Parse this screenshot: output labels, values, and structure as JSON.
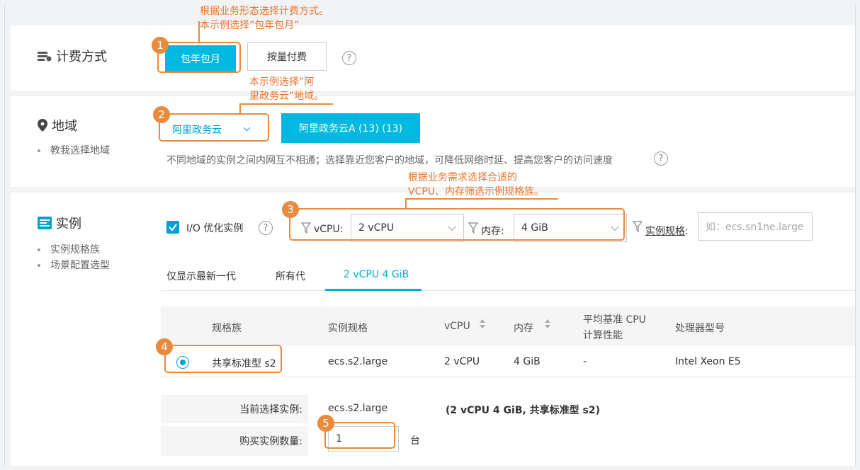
{
  "billing": {
    "title": "计费方式",
    "options": [
      "包年包月",
      "按量付费"
    ],
    "selected": "包年包月"
  },
  "region": {
    "title": "地域",
    "help_link": "教我选择地域",
    "select_value": "阿里政务云",
    "zone_button": "阿里政务云A (13) (13)",
    "note": "不同地域的实例之间内网互不相通；选择靠近您客户的地域，可降低网络时延、提高您客户的访问速度"
  },
  "instance": {
    "title": "实例",
    "links": [
      "实例规格族",
      "场景配置选型"
    ],
    "io_optimized_label": "I/O 优化实例",
    "io_optimized_checked": true,
    "filters": {
      "vcpu_label": "vCPU:",
      "vcpu_value": "2 vCPU",
      "memory_label": "内存:",
      "memory_value": "4 GiB",
      "spec_label": "实例规格",
      "spec_colon": ":",
      "spec_placeholder": "如：ecs.sn1ne.large"
    },
    "tabs": [
      "仅显示最新一代",
      "所有代",
      "2 vCPU 4 GiB"
    ],
    "active_tab": "2 vCPU 4 GiB",
    "table": {
      "headers": [
        "规格族",
        "实例规格",
        "vCPU",
        "内存",
        "平均基准 CPU\n计算性能",
        "处理器型号"
      ],
      "headers_cpu_line1": "平均基准 CPU",
      "headers_cpu_line2": "计算性能",
      "rows": [
        {
          "family": "共享标准型 s2",
          "spec": "ecs.s2.large",
          "vcpu": "2 vCPU",
          "memory": "4 GiB",
          "cpu_perf": "-",
          "processor": "Intel Xeon E5"
        }
      ]
    },
    "current_label": "当前选择实例:",
    "current_value": "ecs.s2.large",
    "current_detail": "(2 vCPU 4 GiB, 共享标准型 s2)",
    "quantity_label": "购买实例数量:",
    "quantity_value": "1",
    "quantity_unit": "台"
  },
  "annotations": {
    "step1_line1": "根据业务形态选择计费方式。",
    "step1_line2": "本示例选择”包年包月”",
    "step2_line1": "本示例选择”阿",
    "step2_line2": "里政务云”地域。",
    "step3_line1": "根据业务需求选择合适的",
    "step3_line2": "VCPU、内存筛选示例规格族。",
    "badges": [
      "1",
      "2",
      "3",
      "4",
      "5"
    ]
  },
  "colors": {
    "primary": "#00b9e0",
    "annotation": "#e98a3c",
    "active_tab": "#00b1d8"
  }
}
